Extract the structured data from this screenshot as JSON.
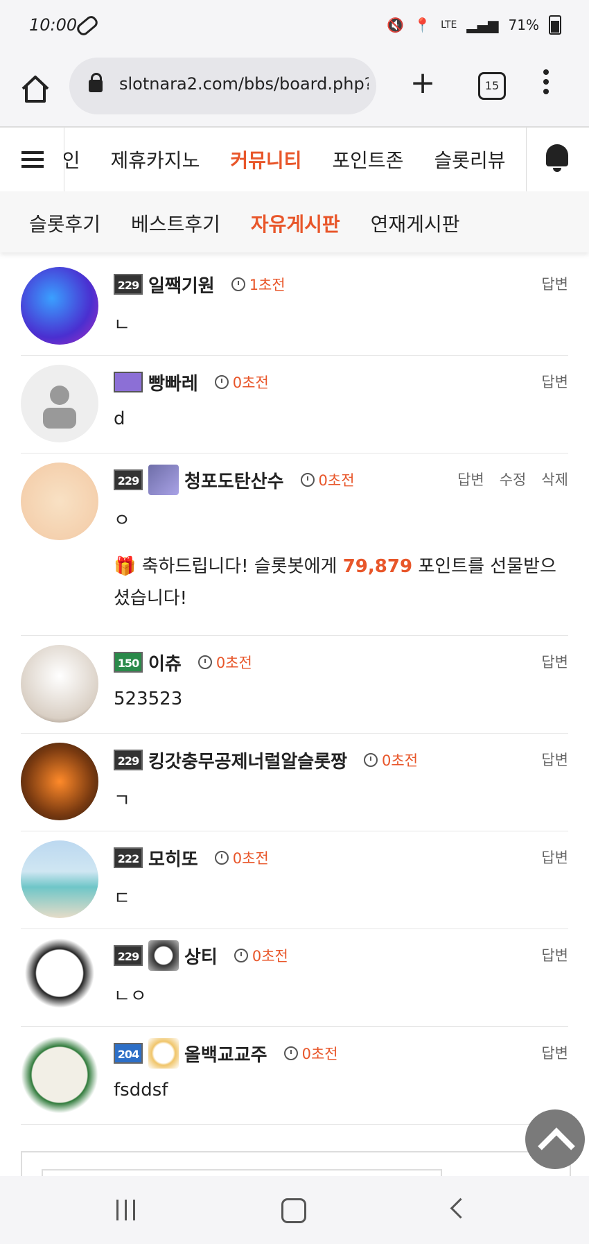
{
  "status": {
    "time": "10:00",
    "network": "LTE",
    "battery": "71%"
  },
  "browser": {
    "url": "slotnara2.com/bbs/board.php?",
    "tab_count": "15"
  },
  "nav_primary": {
    "items": [
      "메인",
      "제휴카지노",
      "커뮤니티",
      "포인트존",
      "슬롯리뷰"
    ],
    "active_index": 2
  },
  "nav_secondary": {
    "items": [
      "슬롯후기",
      "베스트후기",
      "자유게시판",
      "연재게시판"
    ],
    "active_index": 2
  },
  "comments": [
    {
      "level": "229",
      "nickname": "일짹기원",
      "time": "1초전",
      "text": "ㄴ",
      "actions": [
        "답변"
      ]
    },
    {
      "level": "",
      "nickname": "빵빠레",
      "time": "0초전",
      "text": "d",
      "actions": [
        "답변"
      ]
    },
    {
      "level": "229",
      "nickname": "청포도탄산수",
      "time": "0초전",
      "text": "ㅇ",
      "actions": [
        "답변",
        "수정",
        "삭제"
      ],
      "gift": {
        "prefix": "축하드립니다! 슬롯봇에게 ",
        "points": "79,879",
        "suffix": " 포인트를 선물받으셨습니다!"
      }
    },
    {
      "level": "150",
      "nickname": "이츄",
      "time": "0초전",
      "text": "523523",
      "actions": [
        "답변"
      ]
    },
    {
      "level": "229",
      "nickname": "킹갓충무공제너럴알슬롯짱",
      "time": "0초전",
      "text": "ㄱ",
      "actions": [
        "답변"
      ]
    },
    {
      "level": "222",
      "nickname": "모히또",
      "time": "0초전",
      "text": "ㄷ",
      "actions": [
        "답변"
      ]
    },
    {
      "level": "229",
      "nickname": "상티",
      "time": "0초전",
      "text": "ㄴㅇ",
      "actions": [
        "답변"
      ]
    },
    {
      "level": "204",
      "nickname": "올백교교주",
      "time": "0초전",
      "text": "fsddsf",
      "actions": [
        "답변"
      ]
    }
  ],
  "colors": {
    "accent": "#e8562a"
  }
}
